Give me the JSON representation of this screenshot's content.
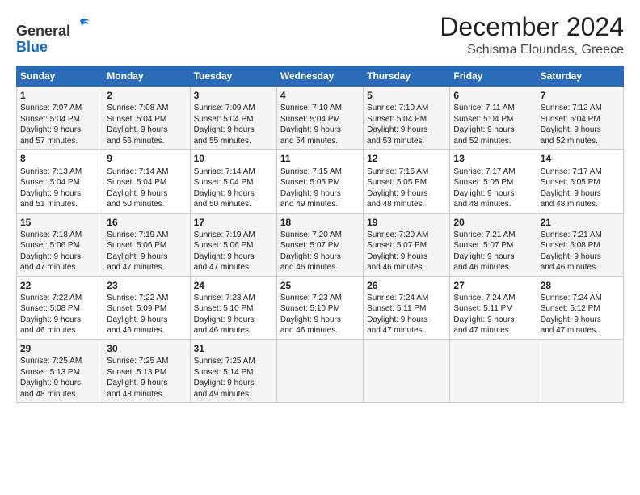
{
  "logo": {
    "text1": "General",
    "text2": "Blue"
  },
  "title": "December 2024",
  "subtitle": "Schisma Eloundas, Greece",
  "headers": [
    "Sunday",
    "Monday",
    "Tuesday",
    "Wednesday",
    "Thursday",
    "Friday",
    "Saturday"
  ],
  "weeks": [
    [
      {
        "day": "1",
        "info": "Sunrise: 7:07 AM\nSunset: 5:04 PM\nDaylight: 9 hours\nand 57 minutes."
      },
      {
        "day": "2",
        "info": "Sunrise: 7:08 AM\nSunset: 5:04 PM\nDaylight: 9 hours\nand 56 minutes."
      },
      {
        "day": "3",
        "info": "Sunrise: 7:09 AM\nSunset: 5:04 PM\nDaylight: 9 hours\nand 55 minutes."
      },
      {
        "day": "4",
        "info": "Sunrise: 7:10 AM\nSunset: 5:04 PM\nDaylight: 9 hours\nand 54 minutes."
      },
      {
        "day": "5",
        "info": "Sunrise: 7:10 AM\nSunset: 5:04 PM\nDaylight: 9 hours\nand 53 minutes."
      },
      {
        "day": "6",
        "info": "Sunrise: 7:11 AM\nSunset: 5:04 PM\nDaylight: 9 hours\nand 52 minutes."
      },
      {
        "day": "7",
        "info": "Sunrise: 7:12 AM\nSunset: 5:04 PM\nDaylight: 9 hours\nand 52 minutes."
      }
    ],
    [
      {
        "day": "8",
        "info": "Sunrise: 7:13 AM\nSunset: 5:04 PM\nDaylight: 9 hours\nand 51 minutes."
      },
      {
        "day": "9",
        "info": "Sunrise: 7:14 AM\nSunset: 5:04 PM\nDaylight: 9 hours\nand 50 minutes."
      },
      {
        "day": "10",
        "info": "Sunrise: 7:14 AM\nSunset: 5:04 PM\nDaylight: 9 hours\nand 50 minutes."
      },
      {
        "day": "11",
        "info": "Sunrise: 7:15 AM\nSunset: 5:05 PM\nDaylight: 9 hours\nand 49 minutes."
      },
      {
        "day": "12",
        "info": "Sunrise: 7:16 AM\nSunset: 5:05 PM\nDaylight: 9 hours\nand 48 minutes."
      },
      {
        "day": "13",
        "info": "Sunrise: 7:17 AM\nSunset: 5:05 PM\nDaylight: 9 hours\nand 48 minutes."
      },
      {
        "day": "14",
        "info": "Sunrise: 7:17 AM\nSunset: 5:05 PM\nDaylight: 9 hours\nand 48 minutes."
      }
    ],
    [
      {
        "day": "15",
        "info": "Sunrise: 7:18 AM\nSunset: 5:06 PM\nDaylight: 9 hours\nand 47 minutes."
      },
      {
        "day": "16",
        "info": "Sunrise: 7:19 AM\nSunset: 5:06 PM\nDaylight: 9 hours\nand 47 minutes."
      },
      {
        "day": "17",
        "info": "Sunrise: 7:19 AM\nSunset: 5:06 PM\nDaylight: 9 hours\nand 47 minutes."
      },
      {
        "day": "18",
        "info": "Sunrise: 7:20 AM\nSunset: 5:07 PM\nDaylight: 9 hours\nand 46 minutes."
      },
      {
        "day": "19",
        "info": "Sunrise: 7:20 AM\nSunset: 5:07 PM\nDaylight: 9 hours\nand 46 minutes."
      },
      {
        "day": "20",
        "info": "Sunrise: 7:21 AM\nSunset: 5:07 PM\nDaylight: 9 hours\nand 46 minutes."
      },
      {
        "day": "21",
        "info": "Sunrise: 7:21 AM\nSunset: 5:08 PM\nDaylight: 9 hours\nand 46 minutes."
      }
    ],
    [
      {
        "day": "22",
        "info": "Sunrise: 7:22 AM\nSunset: 5:08 PM\nDaylight: 9 hours\nand 46 minutes."
      },
      {
        "day": "23",
        "info": "Sunrise: 7:22 AM\nSunset: 5:09 PM\nDaylight: 9 hours\nand 46 minutes."
      },
      {
        "day": "24",
        "info": "Sunrise: 7:23 AM\nSunset: 5:10 PM\nDaylight: 9 hours\nand 46 minutes."
      },
      {
        "day": "25",
        "info": "Sunrise: 7:23 AM\nSunset: 5:10 PM\nDaylight: 9 hours\nand 46 minutes."
      },
      {
        "day": "26",
        "info": "Sunrise: 7:24 AM\nSunset: 5:11 PM\nDaylight: 9 hours\nand 47 minutes."
      },
      {
        "day": "27",
        "info": "Sunrise: 7:24 AM\nSunset: 5:11 PM\nDaylight: 9 hours\nand 47 minutes."
      },
      {
        "day": "28",
        "info": "Sunrise: 7:24 AM\nSunset: 5:12 PM\nDaylight: 9 hours\nand 47 minutes."
      }
    ],
    [
      {
        "day": "29",
        "info": "Sunrise: 7:25 AM\nSunset: 5:13 PM\nDaylight: 9 hours\nand 48 minutes."
      },
      {
        "day": "30",
        "info": "Sunrise: 7:25 AM\nSunset: 5:13 PM\nDaylight: 9 hours\nand 48 minutes."
      },
      {
        "day": "31",
        "info": "Sunrise: 7:25 AM\nSunset: 5:14 PM\nDaylight: 9 hours\nand 49 minutes."
      },
      {
        "day": "",
        "info": ""
      },
      {
        "day": "",
        "info": ""
      },
      {
        "day": "",
        "info": ""
      },
      {
        "day": "",
        "info": ""
      }
    ]
  ]
}
